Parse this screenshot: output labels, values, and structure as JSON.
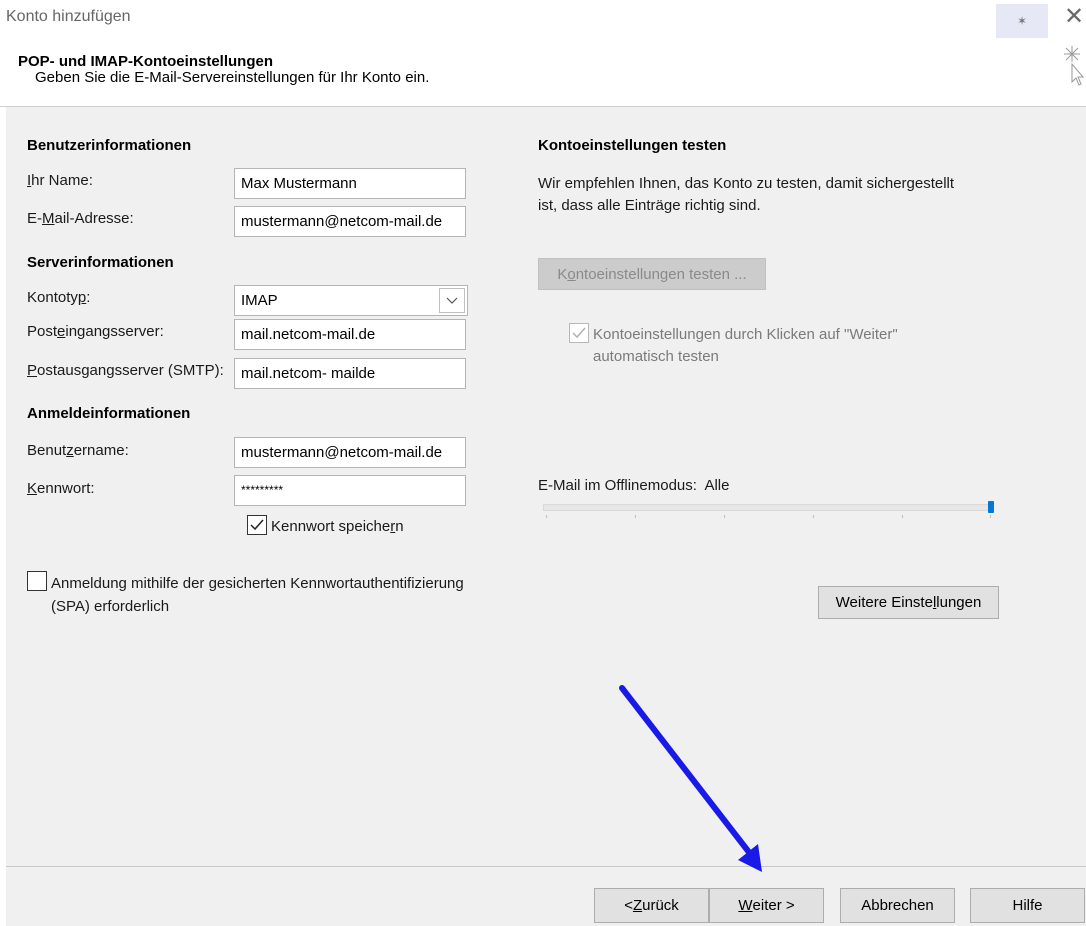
{
  "window": {
    "title": "Konto hinzufügen"
  },
  "header": {
    "heading": "POP- und IMAP-Kontoeinstellungen",
    "subheading": "Geben Sie die E-Mail-Servereinstellungen für Ihr Konto ein."
  },
  "user_info": {
    "section": "Benutzerinformationen",
    "name_label_ul": "I",
    "name_label_rest": "hr Name:",
    "name_value": "Max Mustermann",
    "email_label_pre": "E-",
    "email_label_ul": "M",
    "email_label_rest": "ail-Adresse:",
    "email_value": "mustermann@netcom-mail.de"
  },
  "server_info": {
    "section": "Serverinformationen",
    "type_label_pre": "Kontoty",
    "type_label_ul": "p",
    "type_label_rest": ":",
    "type_value": "IMAP",
    "incoming_label_pre": "Post",
    "incoming_label_ul": "e",
    "incoming_label_rest": "ingangsserver:",
    "incoming_value": "mail.netcom-mail.de",
    "outgoing_label_ul": "P",
    "outgoing_label_rest": "ostausgangsserver (SMTP):",
    "outgoing_value": "mail.netcom- mailde"
  },
  "login_info": {
    "section": "Anmeldeinformationen",
    "username_label_pre": "Benut",
    "username_label_ul": "z",
    "username_label_rest": "ername:",
    "username_value": "mustermann@netcom-mail.de",
    "password_label_ul": "K",
    "password_label_rest": "ennwort:",
    "password_value": "*********",
    "remember_pre": "Kennwort speiche",
    "remember_ul": "r",
    "remember_rest": "n",
    "remember_checked": true
  },
  "spa": {
    "line1_pre": "Anmeldun",
    "line1_ul": "g",
    "line1_rest": " mithilfe der gesicherten Kennwortauthentifizierung",
    "line2": "(SPA) erforderlich",
    "checked": false
  },
  "test": {
    "section": "Kontoeinstellungen testen",
    "desc_line1": "Wir empfehlen Ihnen, das Konto zu testen, damit sichergestellt",
    "desc_line2": "ist, dass alle Einträge richtig sind.",
    "button_pre": "K",
    "button_ul": "o",
    "button_rest": "ntoeinstellungen testen ...",
    "auto_line1": "Kontoeinstellungen durch Klicken auf \"Weiter\"",
    "auto_line2": "automatisch testen",
    "auto_checked": true
  },
  "offline": {
    "label": "E-Mail im Offlinemodus:",
    "value": "Alle",
    "level_percent": 100
  },
  "more_settings": {
    "pre": "Weitere Einste",
    "ul": "l",
    "rest": "lungen"
  },
  "footer": {
    "back_pre": "< ",
    "back_ul": "Z",
    "back_rest": "urück",
    "next_ul": "W",
    "next_rest": "eiter >",
    "cancel": "Abbrechen",
    "help": "Hilfe"
  },
  "colors": {
    "accent": "#0078d7",
    "arrow": "#1a1ae6",
    "panel": "#f0f0f0"
  },
  "icons": [
    "close-icon",
    "pin-icon",
    "cursor-icon",
    "chevron-down-icon",
    "checkmark-icon",
    "annotation-arrow"
  ]
}
